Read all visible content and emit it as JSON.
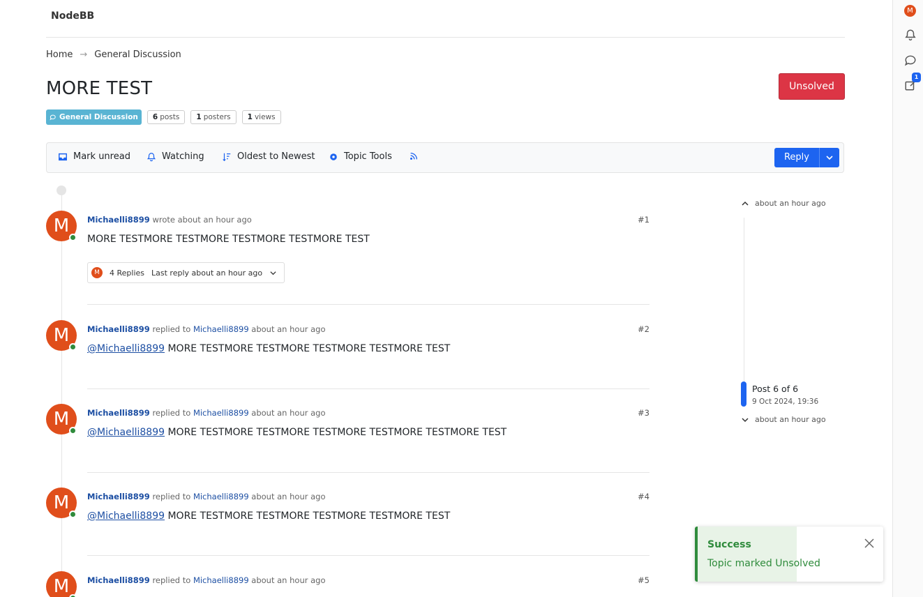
{
  "brand": "NodeBB",
  "breadcrumb": {
    "home": "Home",
    "category": "General Discussion"
  },
  "topic": {
    "title": "MORE TEST",
    "status_button": "Unsolved",
    "category_badge": "General Discussion",
    "stats": [
      {
        "count": "6",
        "label": "posts"
      },
      {
        "count": "1",
        "label": "posters"
      },
      {
        "count": "1",
        "label": "views"
      }
    ]
  },
  "toolbar": {
    "mark_unread": "Mark unread",
    "watching": "Watching",
    "sort": "Oldest to Newest",
    "topic_tools": "Topic Tools",
    "reply": "Reply"
  },
  "rail": {
    "avatar_letter": "M",
    "drafts_badge": "1"
  },
  "posts": [
    {
      "avatar": "M",
      "author": "Michaelli8899",
      "action": "wrote about an hour ago",
      "index": "#1",
      "mention": "",
      "body": "MORE TESTMORE TESTMORE TESTMORE TESTMORE TEST",
      "replies_count": "4 Replies",
      "last_reply": "Last reply about an hour ago"
    },
    {
      "avatar": "M",
      "author": "Michaelli8899",
      "action": "replied to",
      "target": "Michaelli8899",
      "time": "about an hour ago",
      "index": "#2",
      "mention": "@Michaelli8899",
      "body": " MORE TESTMORE TESTMORE TESTMORE TESTMORE TEST"
    },
    {
      "avatar": "M",
      "author": "Michaelli8899",
      "action": "replied to",
      "target": "Michaelli8899",
      "time": "about an hour ago",
      "index": "#3",
      "mention": "@Michaelli8899",
      "body": " MORE TESTMORE TESTMORE TESTMORE TESTMORE TESTMORE TEST"
    },
    {
      "avatar": "M",
      "author": "Michaelli8899",
      "action": "replied to",
      "target": "Michaelli8899",
      "time": "about an hour ago",
      "index": "#4",
      "mention": "@Michaelli8899",
      "body": " MORE TESTMORE TESTMORE TESTMORE TESTMORE TEST"
    },
    {
      "avatar": "M",
      "author": "Michaelli8899",
      "action": "replied to",
      "target": "Michaelli8899",
      "time": "about an hour ago",
      "index": "#5"
    }
  ],
  "pager": {
    "top_time": "about an hour ago",
    "label": "Post 6 of 6",
    "date": "9 Oct 2024, 19:36",
    "bottom_time": "about an hour ago"
  },
  "toast": {
    "title": "Success",
    "message": "Topic marked Unsolved"
  },
  "colors": {
    "accent": "#1d64f0",
    "danger": "#dc3545",
    "success": "#2f8b3c",
    "avatar": "#e04e1b",
    "category": "#59b4d3"
  }
}
